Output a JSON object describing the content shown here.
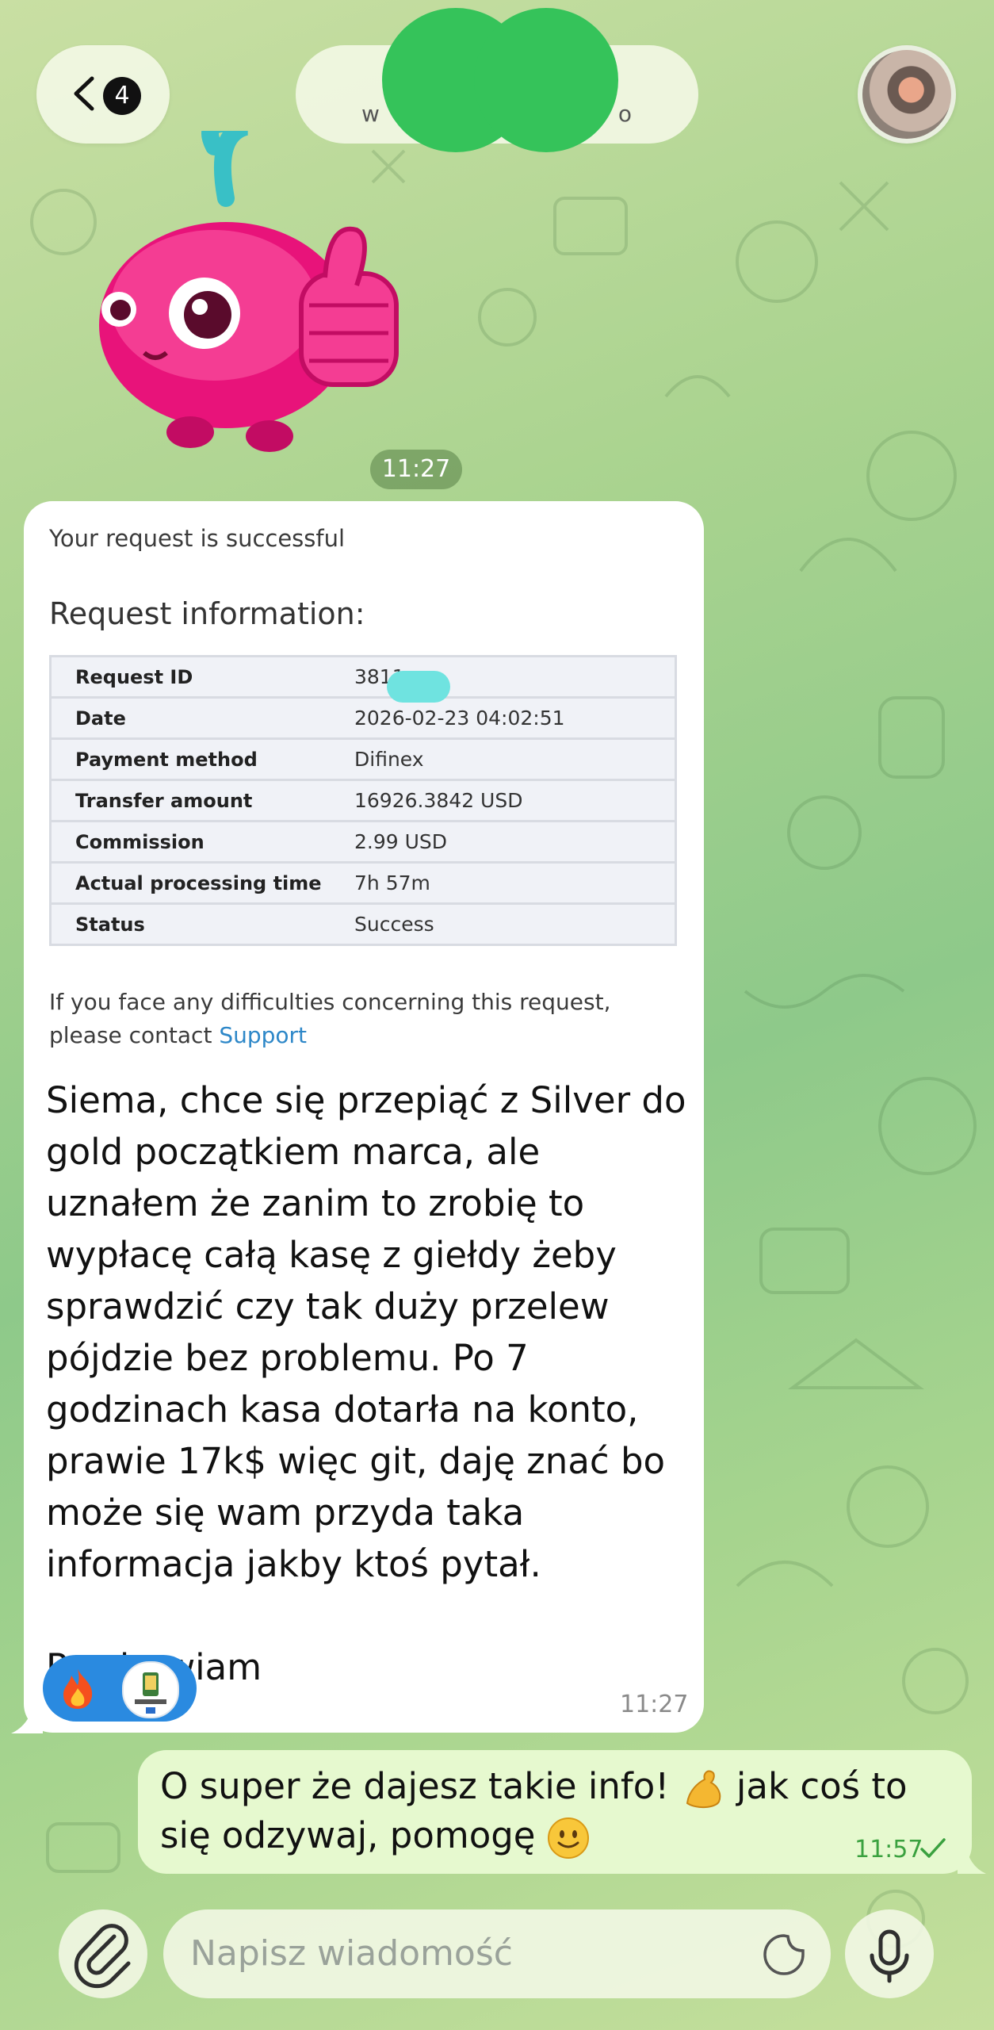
{
  "header": {
    "back_badge": "4",
    "chat_title": "w",
    "chat_title_tail": "o"
  },
  "sticker_time": "11:27",
  "receipt": {
    "status_line": "Your request is successful",
    "section_title": "Request information:",
    "rows": [
      {
        "label": "Request ID",
        "value": "3811"
      },
      {
        "label": "Date",
        "value": "2026-02-23 04:02:51"
      },
      {
        "label": "Payment method",
        "value": "Difinex"
      },
      {
        "label": "Transfer amount",
        "value": "16926.3842 USD"
      },
      {
        "label": "Commission",
        "value": "2.99 USD"
      },
      {
        "label": "Actual processing time",
        "value": "7h 57m"
      },
      {
        "label": "Status",
        "value": "Success"
      }
    ],
    "help_text": "If you face any difficulties concerning this request, please contact",
    "support_link": "Support"
  },
  "incoming": {
    "message": "Siema, chce się przepiąć z Silver do gold początkiem marca, ale uznałem że zanim to zrobię to wypłacę całą kasę z giełdy żeby sprawdzić czy tak duży przelew pójdzie bez problemu. Po 7 godzinach kasa dotarła na konto, prawie 17k$ więc git, daję znać bo może się wam przyda taka informacja jakby ktoś pytał.\n\nPozdrawiam",
    "time": "11:27",
    "reactions": [
      "fire-emoji",
      "reactor-avatar"
    ]
  },
  "outgoing": {
    "message_part1": "O super że dajesz takie info!",
    "message_part2": "jak coś to się odzywaj, pomogę",
    "time": "11:57",
    "status": "read-check"
  },
  "composer": {
    "placeholder": "Napisz wiadomość"
  },
  "icons": [
    "chevron-left-icon",
    "paperclip-icon",
    "sticker-icon",
    "microphone-icon",
    "check-icon"
  ],
  "colors": {
    "accent": "#2a8ae0",
    "outgoing_bubble": "#e6f9cf",
    "incoming_bubble": "#ffffff",
    "time_chip": "#6e965a",
    "read_check": "#3aa13f",
    "link": "#2d87c8"
  }
}
